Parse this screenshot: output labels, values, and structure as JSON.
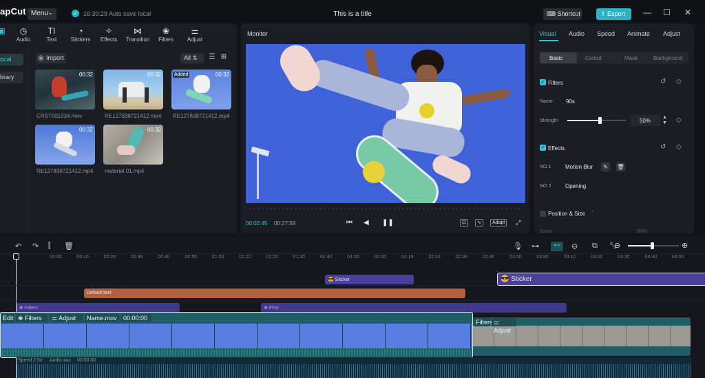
{
  "titlebar": {
    "app_name": "apCut",
    "menu_label": "Menu",
    "autosave_text": "16:30:29 Auto save local",
    "title": "This is a title",
    "shortcut_label": "Shortcut",
    "export_label": "Export"
  },
  "toolbar": {
    "items": [
      {
        "label": "",
        "icon": "media-icon"
      },
      {
        "label": "Audio",
        "icon": "audio-icon"
      },
      {
        "label": "Text",
        "icon": "text-icon"
      },
      {
        "label": "Stickers",
        "icon": "sticker-icon"
      },
      {
        "label": "Effects",
        "icon": "effects-icon"
      },
      {
        "label": "Transition",
        "icon": "transition-icon"
      },
      {
        "label": "Filters",
        "icon": "filters-icon"
      },
      {
        "label": "Adjust",
        "icon": "adjust-icon"
      }
    ]
  },
  "sidenav": {
    "items": [
      "ocal",
      "brary"
    ]
  },
  "media": {
    "import_label": "Import",
    "sort_label": "All",
    "items": [
      {
        "name": "CRST001334.mov",
        "duration": "00:32",
        "added": ""
      },
      {
        "name": "RE127838721412.mp4",
        "duration": "00:32",
        "added": ""
      },
      {
        "name": "RE127838721412.mp4",
        "duration": "00:32",
        "added": "Added"
      },
      {
        "name": "RE127838721412.mp4",
        "duration": "00:32",
        "added": ""
      },
      {
        "name": "material 01.mp4",
        "duration": "00:32",
        "added": ""
      }
    ]
  },
  "monitor": {
    "title": "Monitor",
    "current_time": "00:02:45",
    "total_time": "00:27:58",
    "adapt_label": "Adapt"
  },
  "inspector": {
    "tabs": [
      "Visual",
      "Audio",
      "Speed",
      "Animate",
      "Adjust"
    ],
    "subtabs": [
      "Basic",
      "Cutout",
      "Mask",
      "Background"
    ],
    "filters_title": "Filters",
    "name_label": "Name",
    "name_value": "90s",
    "strength_label": "Strength",
    "strength_value": "50%",
    "strength_level": 0.5,
    "effects_title": "Effects",
    "effect1_label": "NO 1",
    "effect1_value": "Motion Blur",
    "effect2_label": "NO 2",
    "effect2_value": "Opening",
    "position_title": "Position & Size",
    "scale_label": "Zoom",
    "scale_value": "50%"
  },
  "timeline": {
    "ruler": [
      "00:00",
      "00:10",
      "00:20",
      "00:30",
      "00:40",
      "00:50",
      "01:00",
      "01:10",
      "01:20",
      "01:30",
      "01:40",
      "01:50",
      "02:00",
      "02:10",
      "02:20",
      "02:30",
      "02:40",
      "02:50",
      "03:00",
      "03:10",
      "03:20",
      "03:30",
      "03:40",
      "03:50"
    ],
    "sticker_clip_1": "Sticker",
    "sticker_clip_2": "Sticker",
    "text_clip": "Default text",
    "filters_clip": "Filters",
    "pine_clip": "Pine",
    "main_chips": {
      "edit": "Edit",
      "filters": "Filters",
      "adjust": "Adjust",
      "name": "Name.mov",
      "time": "00:00:00"
    },
    "second_chips": {
      "filters": "Filters",
      "adjust": "Adjust"
    },
    "audio_speed": "Speed 2.0x",
    "audio_name": "Audio.aac",
    "audio_time": "00:00:00",
    "zoom_level": 0.75
  },
  "colors": {
    "accent": "#2fc5d4",
    "sticker": "#5b4fae",
    "text_clip": "#b4603d",
    "filter_clip": "#4a3f9b",
    "video_track": "#1e5e64"
  }
}
